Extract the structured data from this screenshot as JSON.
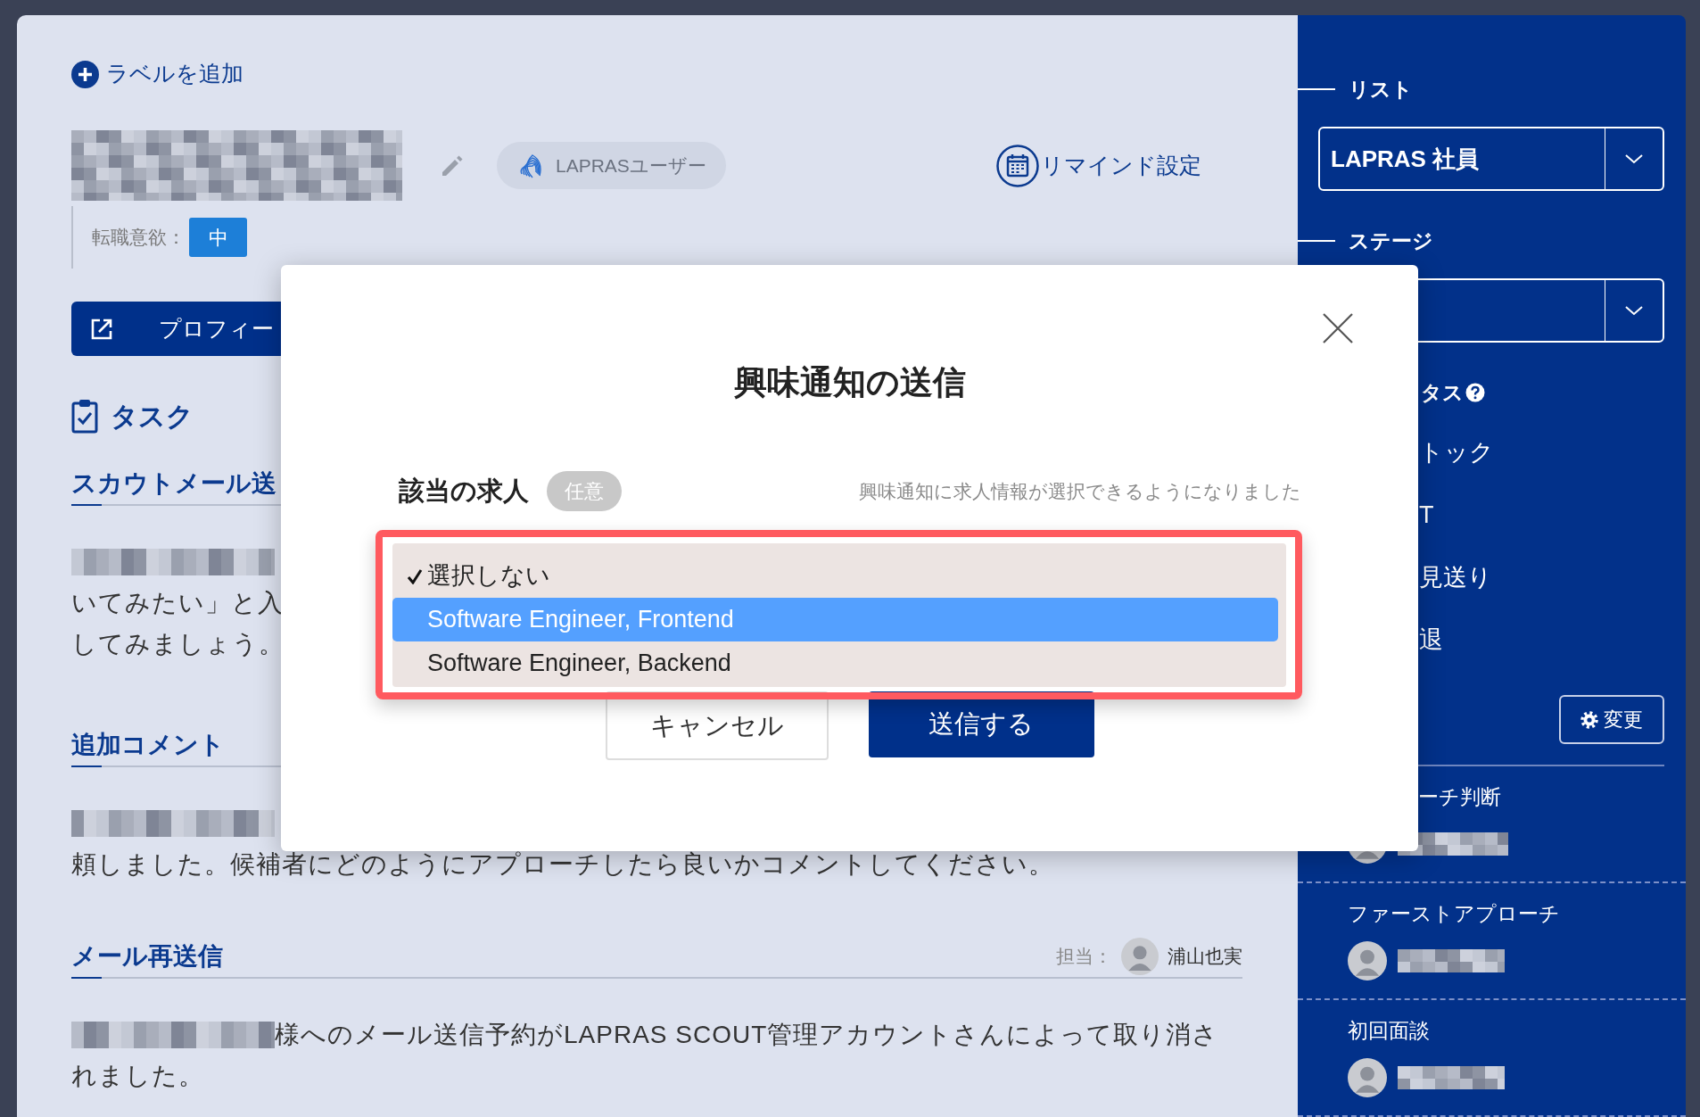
{
  "panel": {
    "add_label": "ラベルを追加",
    "user_tag": "LAPRASユーザー",
    "remind": "リマインド設定",
    "motivation_label": "転職意欲：",
    "motivation_value": "中",
    "profile_button": "プロフィー",
    "tasks_title": "タスク",
    "sections": [
      {
        "title": "スカウトメール送",
        "lines": [
          {
            "redacted_prefix": true
          },
          {
            "text": "いてみたい」と入"
          },
          {
            "text": "してみましょう。"
          }
        ]
      },
      {
        "title": "追加コメント",
        "lines": [
          {
            "redacted_prefix": true
          },
          {
            "text": "頼しました。候補者にどのようにアプローチしたら良いかコメントしてください。"
          }
        ]
      },
      {
        "title": "メール再送信",
        "assignee": {
          "label": "担当：",
          "name": "浦山也実"
        },
        "lines": [
          {
            "redacted_prefix": true,
            "text": "様へのメール送信予約がLAPRAS SCOUT管理アカウントさんによって取り消さ"
          },
          {
            "text": "れました。"
          }
        ]
      }
    ]
  },
  "sidebar": {
    "list_label": "リスト",
    "list_value": "LAPRAS 社員",
    "stage_label": "ステージ",
    "status_label": "タス",
    "status_items": [
      "トック",
      "T",
      "見送り",
      "退"
    ],
    "change_button": "変更",
    "people": [
      {
        "role": "ーチ判断",
        "obscured": true
      },
      {
        "role": "ファーストアプローチ",
        "obscured": false
      },
      {
        "role": "初回面談",
        "obscured": false
      }
    ]
  },
  "modal": {
    "title": "興味通知の送信",
    "field_label": "該当の求人",
    "optional_tag": "任意",
    "hint": "興味通知に求人情報が選択できるようになりました",
    "options": [
      {
        "label": "選択しない",
        "checked": true,
        "selected": false
      },
      {
        "label": "Software Engineer, Frontend",
        "checked": false,
        "selected": true
      },
      {
        "label": "Software Engineer, Backend",
        "checked": false,
        "selected": false
      }
    ],
    "buttons": [
      {
        "label": "キャンセル",
        "kind": "secondary"
      },
      {
        "label": "送信する",
        "kind": "primary"
      }
    ]
  }
}
